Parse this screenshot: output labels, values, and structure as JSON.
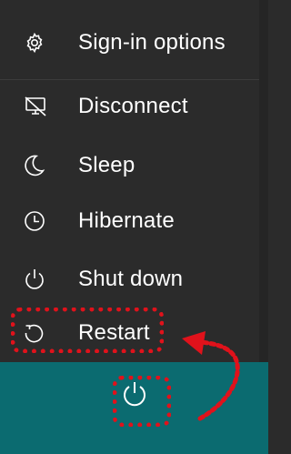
{
  "menu": {
    "items": [
      {
        "label": "Sign-in options",
        "icon": "gear-icon"
      },
      {
        "label": "Disconnect",
        "icon": "disconnect-icon"
      },
      {
        "label": "Sleep",
        "icon": "moon-icon"
      },
      {
        "label": "Hibernate",
        "icon": "clock-icon"
      },
      {
        "label": "Shut down",
        "icon": "power-icon"
      },
      {
        "label": "Restart",
        "icon": "restart-icon"
      }
    ]
  },
  "taskbar": {
    "power_button_icon": "power-icon"
  },
  "colors": {
    "menu_background": "#2b2b2b",
    "taskbar_background": "#0b6b70",
    "annotation": "#e0121b",
    "text": "#ffffff"
  }
}
